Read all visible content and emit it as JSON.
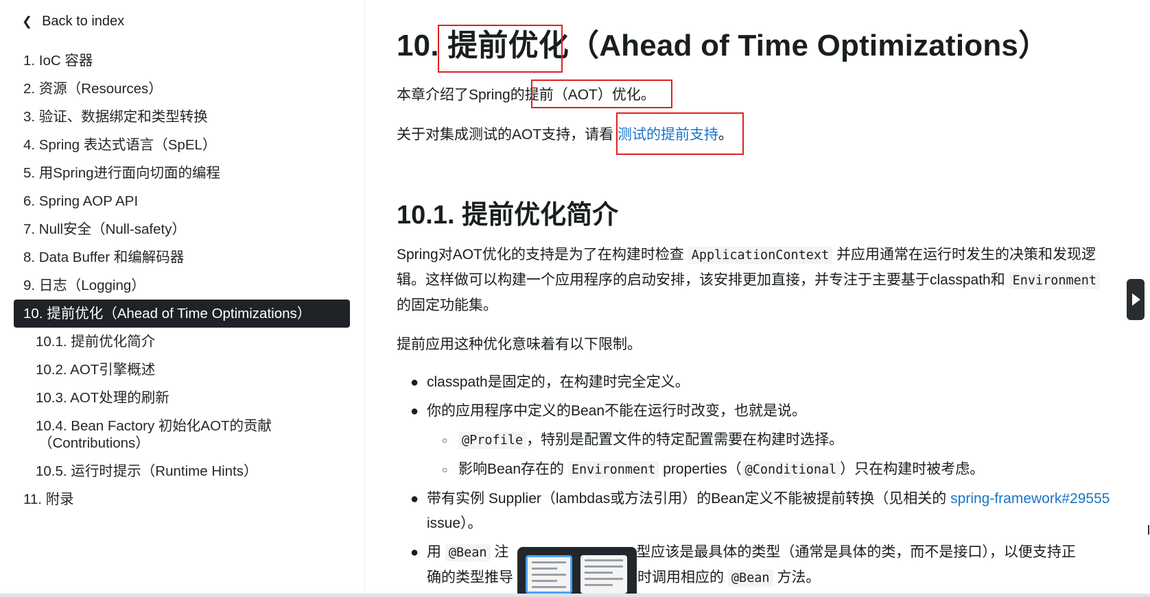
{
  "sidebar": {
    "back_label": "Back to index",
    "items": [
      {
        "label": "1. IoC 容器",
        "level": 1
      },
      {
        "label": "2. 资源（Resources）",
        "level": 1
      },
      {
        "label": "3. 验证、数据绑定和类型转换",
        "level": 1
      },
      {
        "label": "4. Spring 表达式语言（SpEL）",
        "level": 1
      },
      {
        "label": "5. 用Spring进行面向切面的编程",
        "level": 1
      },
      {
        "label": "6. Spring AOP API",
        "level": 1
      },
      {
        "label": "7. Null安全（Null-safety）",
        "level": 1
      },
      {
        "label": "8. Data Buffer 和编解码器",
        "level": 1
      },
      {
        "label": "9. 日志（Logging）",
        "level": 1
      },
      {
        "label": "10. 提前优化（Ahead of Time Optimizations）",
        "level": 1,
        "active": true
      },
      {
        "label": "10.1. 提前优化简介",
        "level": 2
      },
      {
        "label": "10.2. AOT引擎概述",
        "level": 2
      },
      {
        "label": "10.3. AOT处理的刷新",
        "level": 2
      },
      {
        "label": "10.4. Bean Factory 初始化AOT的贡献",
        "label_cont": "（Contributions）",
        "level": 2
      },
      {
        "label": "10.5. 运行时提示（Runtime Hints）",
        "level": 2
      },
      {
        "label": "11. 附录",
        "level": 1
      }
    ]
  },
  "content": {
    "title": "10. 提前优化（Ahead of Time Optimizations）",
    "p1": "本章介绍了Spring的提前（AOT）优化。",
    "p2_text": "关于对集成测试的AOT支持，请看 ",
    "p2_link": "测试的提前支持",
    "p2_end": "。",
    "section_title": "10.1. 提前优化简介",
    "para_a": "Spring对AOT优化的支持是为了在构建时检查 ",
    "para_code1": "ApplicationContext",
    "para_b": " 并应用通常在运行时发生的决策和发现逻辑。这样做可以构建一个应用程序的启动安排，该安排更加直接，并专注于主要基于classpath和 ",
    "para_code2": "Environment",
    "para_c": " 的固定功能集。",
    "p4": "提前应用这种优化意味着有以下限制。",
    "bullet1": "classpath是固定的，在构建时完全定义。",
    "bullet2": "你的应用程序中定义的Bean不能在运行时改变，也就是说。",
    "sub1_code": "@Profile",
    "sub1_text": "，特别是配置文件的特定配置需要在构建时选择。",
    "sub2_a": "影响Bean存在的 ",
    "sub2_code1": "Environment",
    "sub2_b": " properties（",
    "sub2_code2": "@Conditional",
    "sub2_c": "）只在构建时被考虑。",
    "bullet3_a": "带有实例 Supplier（lambdas或方法引用）的Bean定义不能被提前转换（见相关的 ",
    "bullet3_link": "spring-framework#29555",
    "bullet3_b": " issue）。",
    "bullet4_a": "用 ",
    "bullet4_code": "@Bean",
    "bullet4_b": " 注",
    "bullet4_c": "型应该是最具体的类型（通常是具体的类，而不是接口），以便支持正",
    "bullet4_d": "确的类型推导",
    "bullet4_e": "建时调用相应的 ",
    "bullet4_code2": "@Bean",
    "bullet4_f": " 方法。"
  }
}
